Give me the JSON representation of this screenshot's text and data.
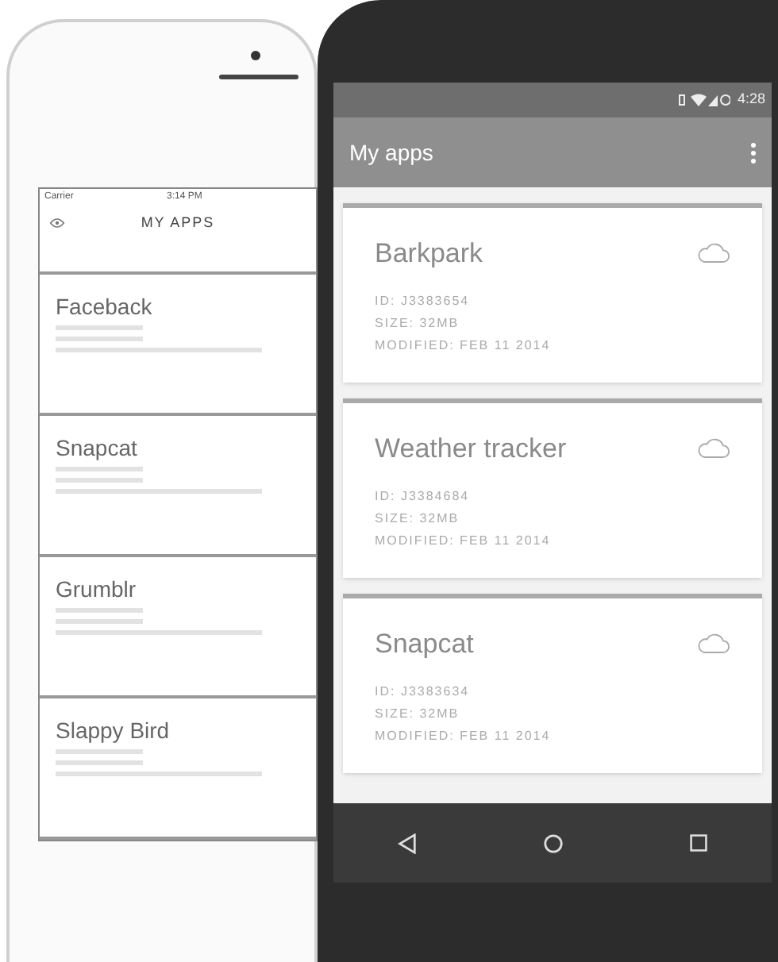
{
  "ios": {
    "status": {
      "carrier": "Carrier",
      "time": "3:14 PM"
    },
    "title": "MY APPS",
    "apps": [
      {
        "name": "Faceback"
      },
      {
        "name": "Snapcat"
      },
      {
        "name": "Grumblr"
      },
      {
        "name": "Slappy Bird"
      }
    ]
  },
  "android": {
    "status": {
      "time": "4:28"
    },
    "title": "My apps",
    "apps": [
      {
        "name": "Barkpark",
        "id": "ID: J3383654",
        "size": "SIZE: 32MB",
        "modified": "MODIFIED: FEB 11 2014"
      },
      {
        "name": "Weather tracker",
        "id": "ID: J3384684",
        "size": "SIZE: 32MB",
        "modified": "MODIFIED: FEB 11 2014"
      },
      {
        "name": "Snapcat",
        "id": "ID: J3383634",
        "size": "SIZE: 32MB",
        "modified": "MODIFIED: FEB 11 2014"
      }
    ]
  }
}
